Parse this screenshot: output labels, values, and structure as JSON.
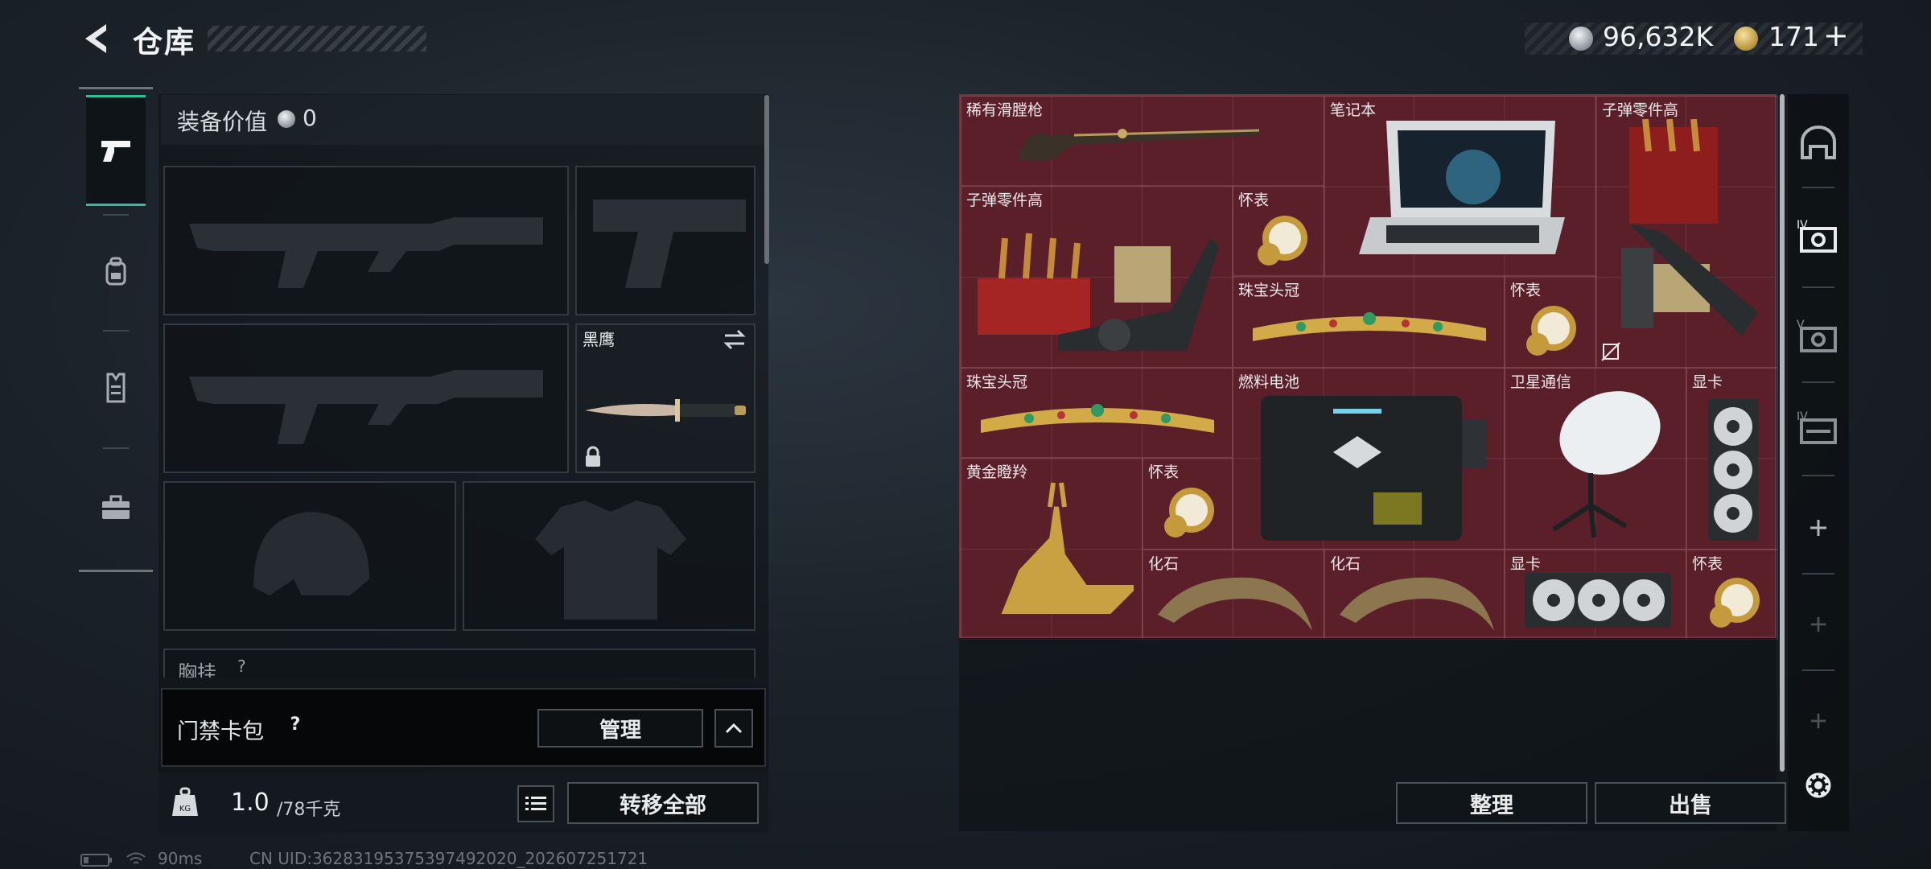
{
  "header": {
    "title": "仓库"
  },
  "currency": {
    "silver_amount": "96,632K",
    "gold_amount": "171",
    "gold_plus": "+"
  },
  "sidebar": {
    "tabs": [
      {
        "name": "weapons",
        "icon": "pistol-icon",
        "active": true
      },
      {
        "name": "backpack",
        "icon": "backpack-icon",
        "active": false
      },
      {
        "name": "vest",
        "icon": "vest-icon",
        "active": false
      },
      {
        "name": "case",
        "icon": "briefcase-icon",
        "active": false
      }
    ]
  },
  "equipment": {
    "value_label": "装备价值",
    "value_amount": "0",
    "melee_name": "黑鹰",
    "chest_label": "胸挂",
    "chest_help": "?"
  },
  "access_card": {
    "label": "门禁卡包",
    "help": "?",
    "manage_label": "管理"
  },
  "weight": {
    "current": "1.0",
    "max": "/78千克",
    "icon_text": "KG"
  },
  "transfer_all_label": "转移全部",
  "status": {
    "ping": "90ms",
    "uid": "CN UID:362831953753974920​20_202607251721"
  },
  "storage": {
    "items": [
      {
        "label": "稀有滑膛枪",
        "icon": "musket-icon"
      },
      {
        "label": "笔记本",
        "icon": "laptop-icon"
      },
      {
        "label": "子弹零件高",
        "icon": "ammo-parts-icon"
      },
      {
        "label": "子弹零件高",
        "icon": "ammo-parts-icon"
      },
      {
        "label": "怀表",
        "icon": "pocket-watch-icon"
      },
      {
        "label": "珠宝头冠",
        "icon": "tiara-icon"
      },
      {
        "label": "怀表",
        "icon": "pocket-watch-icon"
      },
      {
        "label": "珠宝头冠",
        "icon": "tiara-icon"
      },
      {
        "label": "燃料电池",
        "icon": "fuel-cell-icon"
      },
      {
        "label": "卫星通信",
        "icon": "satellite-dish-icon"
      },
      {
        "label": "显卡",
        "icon": "graphics-card-icon"
      },
      {
        "label": "黄金瞪羚",
        "icon": "golden-gazelle-icon"
      },
      {
        "label": "怀表",
        "icon": "pocket-watch-icon"
      },
      {
        "label": "化石",
        "icon": "fossil-claw-icon"
      },
      {
        "label": "化石",
        "icon": "fossil-claw-icon"
      },
      {
        "label": "显卡",
        "icon": "graphics-card-icon"
      },
      {
        "label": "怀表",
        "icon": "pocket-watch-icon"
      }
    ]
  },
  "actions": {
    "sort_label": "整理",
    "sell_label": "出售"
  },
  "side_rail": {
    "icons": [
      "helmet-icon",
      "storage-page-4-icon",
      "storage-page-5-icon",
      "storage-page-6-icon",
      "add-page-icon",
      "add-page-icon",
      "add-page-icon",
      "settings-gear-icon"
    ]
  },
  "colors": {
    "accent": "#2bc19a",
    "grid_bg": "#5a1f29"
  }
}
